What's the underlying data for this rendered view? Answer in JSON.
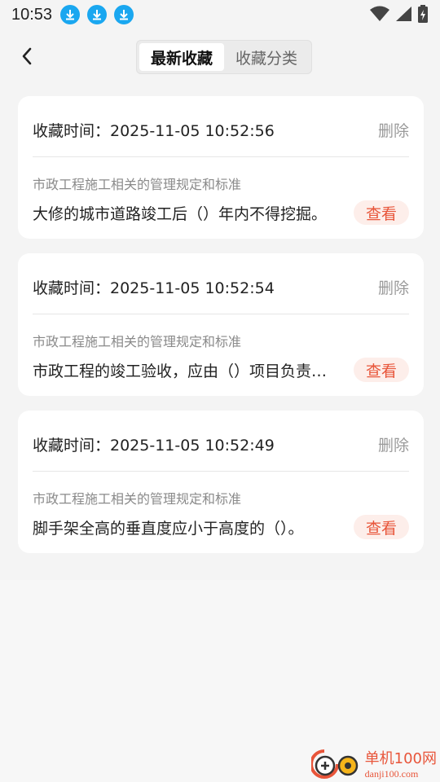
{
  "status": {
    "time": "10:53",
    "download_icons": [
      "download-icon",
      "download-icon",
      "download-icon"
    ],
    "right_icons": [
      "wifi-icon",
      "signal-icon",
      "battery-icon"
    ]
  },
  "header": {
    "back_icon": "chevron-left-icon",
    "tabs": [
      {
        "label": "最新收藏",
        "active": true
      },
      {
        "label": "收藏分类",
        "active": false
      }
    ]
  },
  "favorites": [
    {
      "time": "收藏时间：2025-11-05 10:52:56",
      "delete_label": "删除",
      "category": "市政工程施工相关的管理规定和标准",
      "question": "大修的城市道路竣工后（）年内不得挖掘。",
      "view_label": "查看"
    },
    {
      "time": "收藏时间：2025-11-05 10:52:54",
      "delete_label": "删除",
      "category": "市政工程施工相关的管理规定和标准",
      "question": "市政工程的竣工验收，应由（）项目负责…",
      "view_label": "查看"
    },
    {
      "time": "收藏时间：2025-11-05 10:52:49",
      "delete_label": "删除",
      "category": "市政工程施工相关的管理规定和标准",
      "question": "脚手架全高的垂直度应小于高度的（）。",
      "view_label": "查看"
    }
  ],
  "watermark": {
    "main": "单机100网",
    "sub": "danji100.com"
  },
  "colors": {
    "accent": "#e8553a",
    "accent_bg": "#fdeeea",
    "download_blue": "#1aa7f0"
  }
}
